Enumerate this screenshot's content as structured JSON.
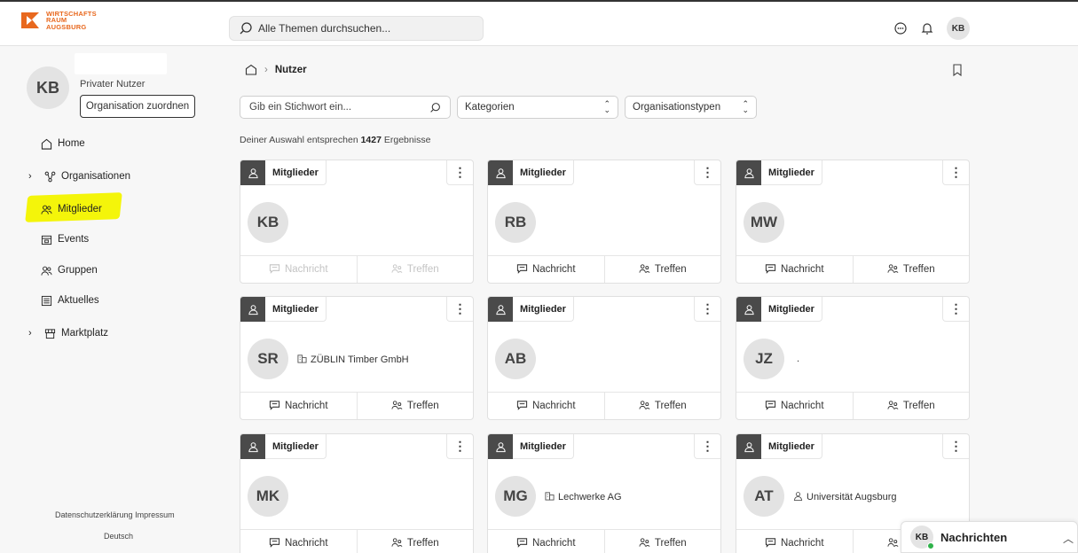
{
  "brand": {
    "logo_text": [
      "WIRTSCHAFTS",
      "RAUM",
      "AUGSBURG"
    ],
    "accent_color": "#e8681e"
  },
  "header": {
    "search_placeholder": "Alle Themen durchsuchen...",
    "icons": [
      "chat-icon",
      "bell-icon"
    ],
    "user_initials": "KB"
  },
  "sidebar": {
    "profile": {
      "initials": "KB",
      "role": "Privater Nutzer",
      "assign_org_label": "Organisation zuordnen"
    },
    "items": [
      {
        "label": "Home",
        "icon": "home-icon",
        "expandable": false
      },
      {
        "label": "Organisationen",
        "icon": "network-icon",
        "expandable": true
      },
      {
        "label": "Mitglieder",
        "icon": "members-icon",
        "expandable": false,
        "active": true
      },
      {
        "label": "Events",
        "icon": "calendar-icon",
        "expandable": false
      },
      {
        "label": "Gruppen",
        "icon": "group-icon",
        "expandable": false
      },
      {
        "label": "Aktuelles",
        "icon": "news-icon",
        "expandable": false
      },
      {
        "label": "Marktplatz",
        "icon": "market-icon",
        "expandable": true
      }
    ],
    "footer": {
      "privacy": "Datenschutzerklärung",
      "imprint": "Impressum",
      "language": "Deutsch"
    },
    "highlight_color": "#f4f50a"
  },
  "main": {
    "breadcrumb": {
      "current": "Nutzer"
    },
    "filters": {
      "keyword_placeholder": "Gib ein Stichwort ein...",
      "category_label": "Kategorien",
      "orgtype_label": "Organisationstypen"
    },
    "results": {
      "prefix": "Deiner Auswahl entsprechen",
      "count": "1427",
      "suffix": "Ergebnisse"
    },
    "cards": [
      {
        "tag": "Mitglieder",
        "initials": "KB",
        "org": "",
        "org_icon": "",
        "actions_disabled": true
      },
      {
        "tag": "Mitglieder",
        "initials": "RB",
        "org": "",
        "org_icon": "",
        "actions_disabled": false
      },
      {
        "tag": "Mitglieder",
        "initials": "MW",
        "org": "",
        "org_icon": "",
        "actions_disabled": false
      },
      {
        "tag": "Mitglieder",
        "initials": "SR",
        "org": "ZÜBLIN Timber GmbH",
        "org_icon": "building-icon",
        "actions_disabled": false
      },
      {
        "tag": "Mitglieder",
        "initials": "AB",
        "org": "",
        "org_icon": "",
        "actions_disabled": false
      },
      {
        "tag": "Mitglieder",
        "initials": "JZ",
        "org": ".",
        "org_icon": "",
        "actions_disabled": false
      },
      {
        "tag": "Mitglieder",
        "initials": "MK",
        "org": "",
        "org_icon": "",
        "actions_disabled": false
      },
      {
        "tag": "Mitglieder",
        "initials": "MG",
        "org": "Lechwerke AG",
        "org_icon": "building-icon",
        "actions_disabled": false
      },
      {
        "tag": "Mitglieder",
        "initials": "AT",
        "org": "Universität Augsburg",
        "org_icon": "graduation-icon",
        "actions_disabled": false
      }
    ],
    "action_labels": {
      "message": "Nachricht",
      "meet": "Treffen"
    }
  },
  "chat": {
    "initials": "KB",
    "title": "Nachrichten",
    "status_color": "#2fb24a"
  }
}
